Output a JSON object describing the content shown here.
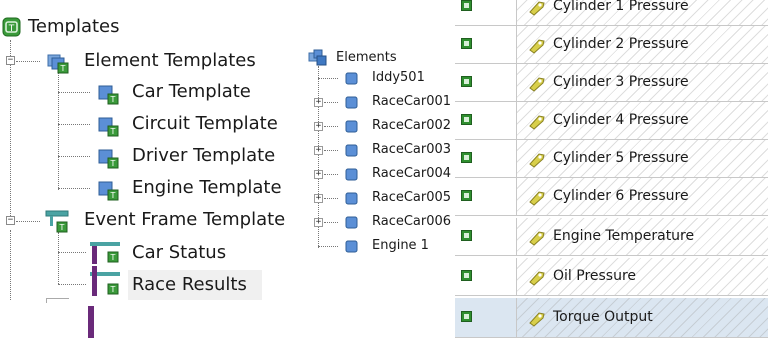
{
  "left_tree": {
    "root": "Templates",
    "element_templates": {
      "label": "Element Templates",
      "children": [
        "Car Template",
        "Circuit Template",
        "Driver Template",
        "Engine Template"
      ]
    },
    "event_frame_templates": {
      "label": "Event Frame Template",
      "children": [
        "Car Status",
        "Race Results"
      ]
    }
  },
  "mid_tree": {
    "root": "Elements",
    "items": [
      "Iddy501",
      "RaceCar001",
      "RaceCar002",
      "RaceCar003",
      "RaceCar004",
      "RaceCar005",
      "RaceCar006",
      "Engine 1"
    ]
  },
  "attributes": {
    "rows": [
      "Cylinder 1 Pressure",
      "Cylinder 2 Pressure",
      "Cylinder 3 Pressure",
      "Cylinder 4 Pressure",
      "Cylinder 5 Pressure",
      "Cylinder 6 Pressure",
      "Engine Temperature",
      "Oil Pressure",
      "Torque Output"
    ],
    "selected_index": 8
  },
  "colors": {
    "template_green": "#3a9a3a",
    "element_blue": "#5b8fd6",
    "event_teal": "#4aa3a3",
    "selection_bg": "#dbe6f1",
    "attribute_icon": "#d8cf4a",
    "purple_marker": "#6a2a7a"
  }
}
